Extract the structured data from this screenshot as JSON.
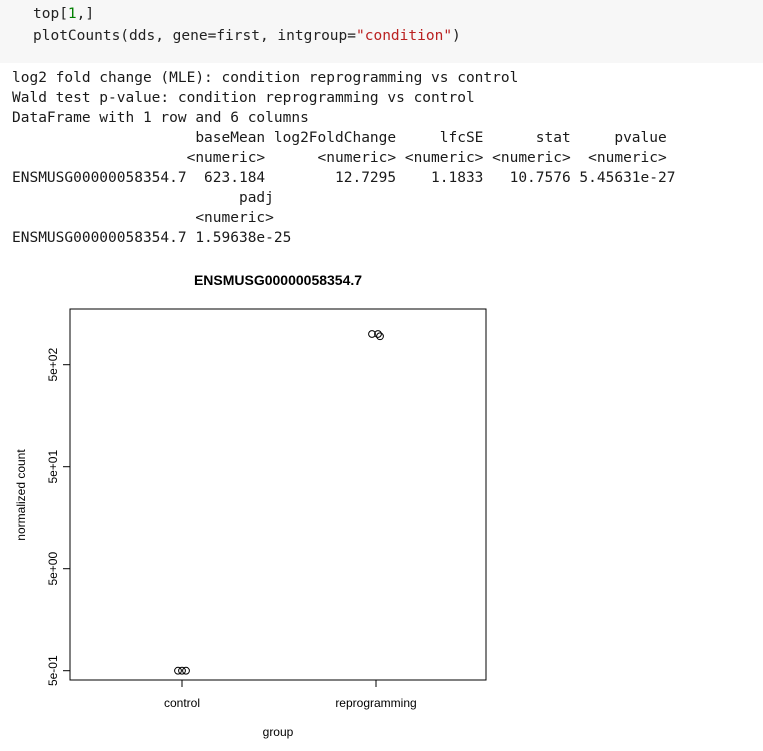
{
  "code": {
    "line1": {
      "a": "top[",
      "n": "1",
      "b": ",]"
    },
    "line2": {
      "a": "plotCounts(dds, gene=first, intgroup=",
      "s": "\"condition\"",
      "b": ")"
    }
  },
  "output": {
    "lines": [
      "log2 fold change (MLE): condition reprogramming vs control",
      "Wald test p-value: condition reprogramming vs control",
      "DataFrame with 1 row and 6 columns",
      "                     baseMean log2FoldChange     lfcSE      stat     pvalue",
      "                    <numeric>      <numeric> <numeric> <numeric>  <numeric>",
      "ENSMUSG00000058354.7  623.184        12.7295    1.1833   10.7576 5.45631e-27",
      "                          padj",
      "                     <numeric>",
      "ENSMUSG00000058354.7 1.59638e-25"
    ]
  },
  "chart_data": {
    "type": "scatter",
    "title": "ENSMUSG00000058354.7",
    "xlabel": "group",
    "ylabel": "normalized count",
    "categories": [
      "control",
      "reprogramming"
    ],
    "y_scale": "log",
    "y_ticks": [
      "5e-01",
      "5e+00",
      "5e+01",
      "5e+02"
    ],
    "points": [
      {
        "group": "control",
        "value": 0.5
      },
      {
        "group": "control",
        "value": 0.5
      },
      {
        "group": "control",
        "value": 0.5
      },
      {
        "group": "reprogramming",
        "value": 1000
      },
      {
        "group": "reprogramming",
        "value": 1000
      },
      {
        "group": "reprogramming",
        "value": 950
      }
    ]
  }
}
